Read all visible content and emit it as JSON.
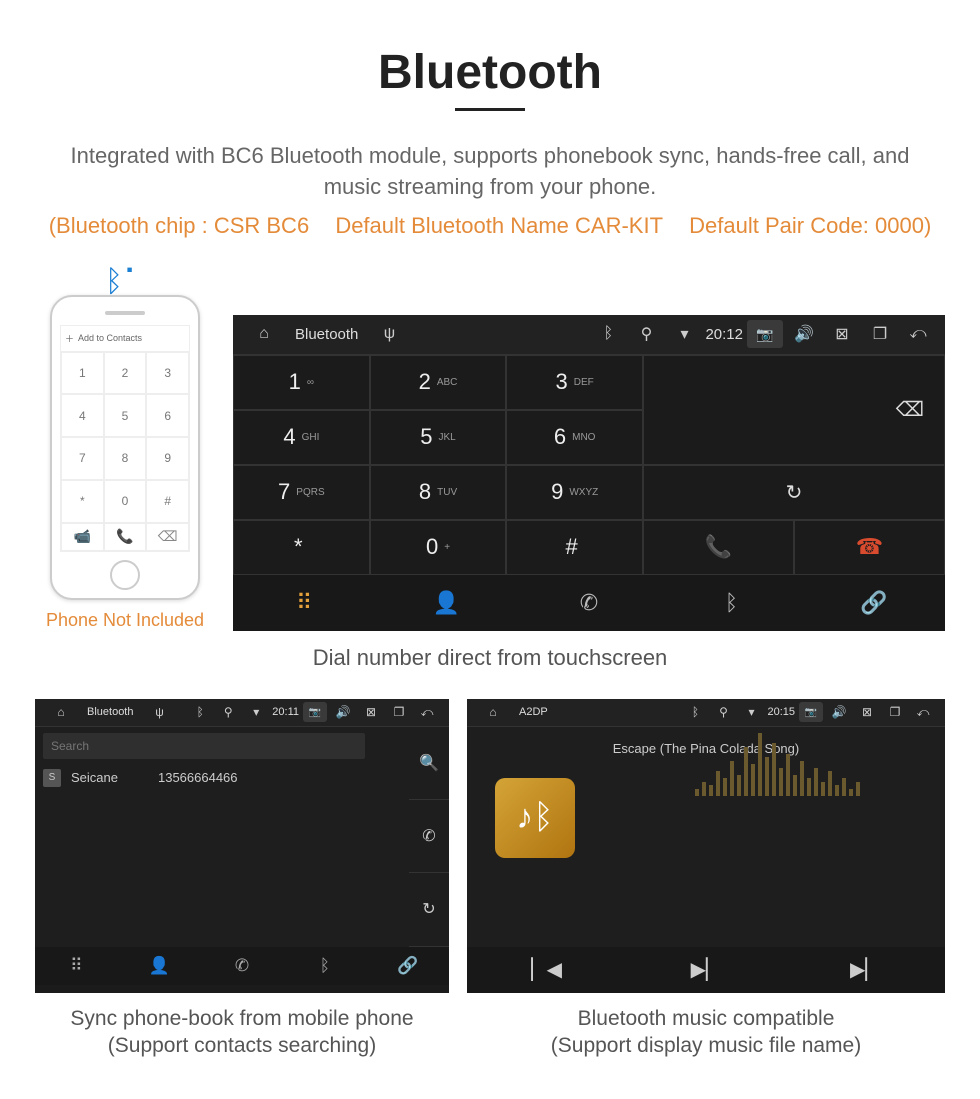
{
  "header": {
    "title": "Bluetooth",
    "intro": "Integrated with BC6 Bluetooth module, supports phonebook sync, hands-free call, and music streaming from your phone.",
    "spec_chip": "(Bluetooth chip : CSR BC6",
    "spec_name": "Default Bluetooth Name CAR-KIT",
    "spec_code": "Default Pair Code: 0000)"
  },
  "phone": {
    "add_contacts": "Add to Contacts",
    "keys": [
      "1",
      "2",
      "3",
      "4",
      "5",
      "6",
      "7",
      "8",
      "9",
      "*",
      "0",
      "#"
    ],
    "not_included": "Phone Not Included"
  },
  "headunit": {
    "bar": {
      "title": "Bluetooth",
      "clock": "20:12"
    },
    "keys": [
      {
        "n": "1",
        "s": "∞"
      },
      {
        "n": "2",
        "s": "ABC"
      },
      {
        "n": "3",
        "s": "DEF"
      },
      {
        "n": "4",
        "s": "GHI"
      },
      {
        "n": "5",
        "s": "JKL"
      },
      {
        "n": "6",
        "s": "MNO"
      },
      {
        "n": "7",
        "s": "PQRS"
      },
      {
        "n": "8",
        "s": "TUV"
      },
      {
        "n": "9",
        "s": "WXYZ"
      },
      {
        "n": "*",
        "s": ""
      },
      {
        "n": "0",
        "s": "+"
      },
      {
        "n": "#",
        "s": ""
      }
    ],
    "caption": "Dial number direct from touchscreen"
  },
  "phonebook": {
    "bar": {
      "title": "Bluetooth",
      "clock": "20:11"
    },
    "search_placeholder": "Search",
    "contact_initial": "S",
    "contact_name": "Seicane",
    "contact_number": "13566664466",
    "caption_line1": "Sync phone-book from mobile phone",
    "caption_line2": "(Support contacts searching)"
  },
  "music": {
    "bar": {
      "title": "A2DP",
      "clock": "20:15"
    },
    "song": "Escape (The Pina Colada Song)",
    "caption_line1": "Bluetooth music compatible",
    "caption_line2": "(Support display music file name)"
  }
}
